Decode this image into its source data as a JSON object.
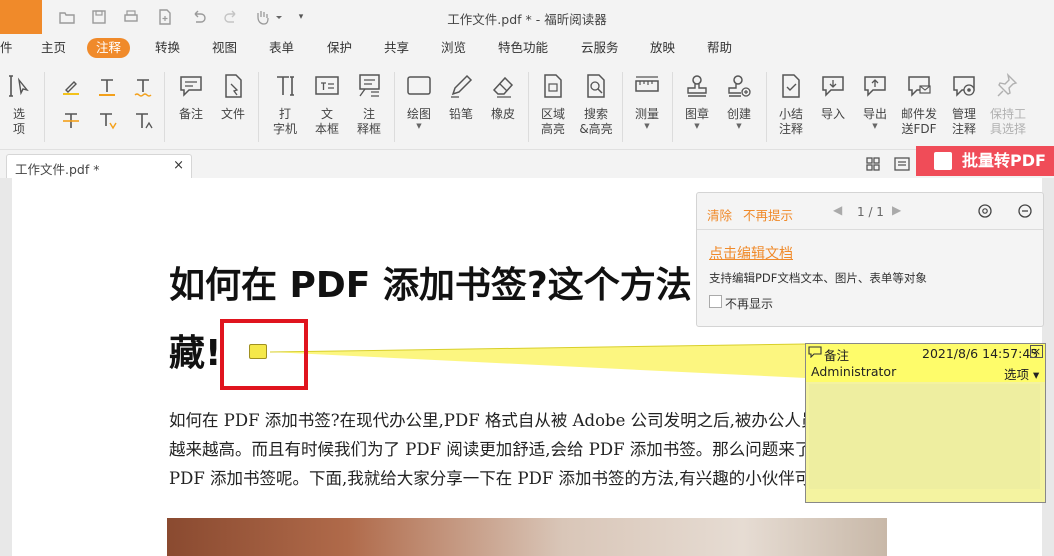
{
  "window": {
    "title": "工作文件.pdf * - 福昕阅读器",
    "logo_fragment": "件"
  },
  "quick_access": [
    "open-icon",
    "save-icon",
    "print-icon",
    "new-icon",
    "undo-icon",
    "redo-icon",
    "hand-icon"
  ],
  "menu": {
    "items": [
      "主页",
      "注释",
      "转换",
      "视图",
      "表单",
      "保护",
      "共享",
      "浏览",
      "特色功能",
      "云服务",
      "放映",
      "帮助"
    ],
    "active": "注释"
  },
  "ribbon": {
    "select": "选\n项",
    "note": "备注",
    "file": "文件",
    "typewriter": "打\n字机",
    "textbox": "文\n本框",
    "callout": "注\n释框",
    "draw": "绘图",
    "pencil": "铅笔",
    "eraser": "橡皮",
    "area_highlight": "区域\n高亮",
    "search_highlight": "搜索\n&高亮",
    "measure": "测量",
    "stamp": "图章",
    "create": "创建",
    "summarize": "小结\n注释",
    "import": "导入",
    "export": "导出",
    "email_fdf": "邮件发\n送FDF",
    "manage": "管理\n注释",
    "keep_tool": "保持工\n具选择"
  },
  "tab": {
    "name": "工作文件.pdf *",
    "close": "×"
  },
  "batch_button": "批量转PDF",
  "document": {
    "title_line1": "如何在 PDF 添加书签?这个方法",
    "title_line2": "藏!",
    "paragraph": "如何在 PDF 添加书签?在现代办公里,PDF 格式自从被 Adobe 公司发明之后,被办公人员使用的频率越来越高。而且有时候我们为了 PDF 阅读更加舒适,会给 PDF 添加书签。那么问题来了,要怎么给 PDF 添加书签呢。下面,我就给大家分享一下在 PDF 添加书签的方法,有兴趣的小伙伴可以看看。"
  },
  "hint_panel": {
    "clear": "清除",
    "no_remind": "不再提示",
    "pager": "1 / 1",
    "link": "点击编辑文档",
    "desc": "支持编辑PDF文档文本、图片、表单等对象",
    "no_show": "不再显示"
  },
  "note_popup": {
    "type": "备注",
    "datetime": "2021/8/6 14:57:45",
    "author": "Administrator",
    "options": "选项 ▾",
    "close": "×"
  },
  "colors": {
    "accent": "#f08a2a",
    "batch": "#f04c58",
    "note_yellow": "#fefc6a",
    "highlight_red": "#e0141e"
  }
}
